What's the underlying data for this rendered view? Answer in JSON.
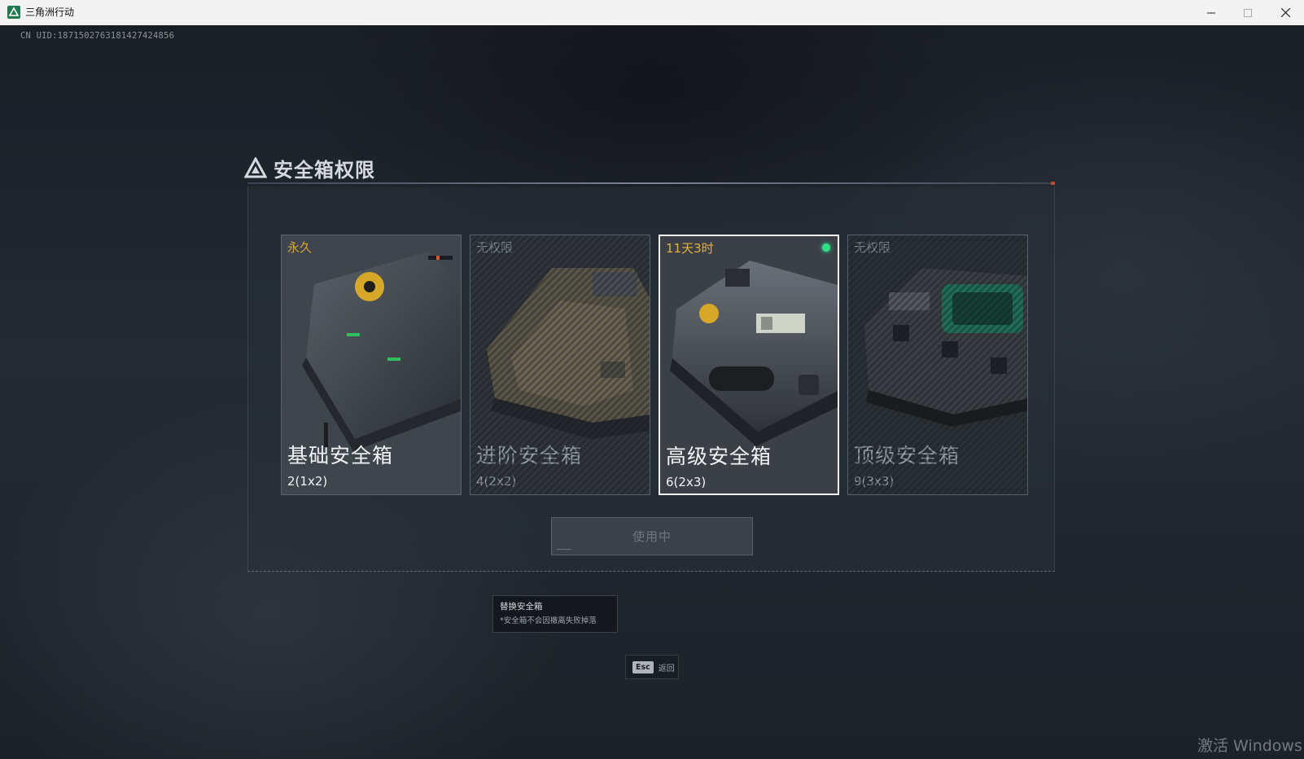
{
  "window": {
    "title": "三角洲行动",
    "controls": {
      "minimize": "minimize-icon",
      "maximize": "maximize-icon",
      "close": "close-icon"
    }
  },
  "uid": "CN UID:1871502763181427424856",
  "panel": {
    "title": "安全箱权限",
    "cards": [
      {
        "duration": "永久",
        "duration_color": "#d9a53a",
        "name": "基础安全箱",
        "capacity": "2(1x2)",
        "selected": false,
        "locked": false,
        "active": false
      },
      {
        "duration": "无权限",
        "duration_color": "#7f868d",
        "name": "进阶安全箱",
        "capacity": "4(2x2)",
        "selected": false,
        "locked": true,
        "active": false
      },
      {
        "duration": "11天3时",
        "duration_color": "#e3b23c",
        "name": "高级安全箱",
        "capacity": "6(2x3)",
        "selected": true,
        "locked": false,
        "active": true
      },
      {
        "duration": "无权限",
        "duration_color": "#7f868d",
        "name": "顶级安全箱",
        "capacity": "9(3x3)",
        "selected": false,
        "locked": true,
        "active": false
      }
    ],
    "use_button": "使用中"
  },
  "tooltip": {
    "title": "替换安全箱",
    "note": "*安全箱不会因撤离失败掉落"
  },
  "esc": {
    "key": "Esc",
    "label": "返回"
  },
  "watermark": "激活 Windows",
  "colors": {
    "accent_green": "#2fe08a",
    "gold": "#e3b23c",
    "title_accent": "#c04b2e"
  }
}
